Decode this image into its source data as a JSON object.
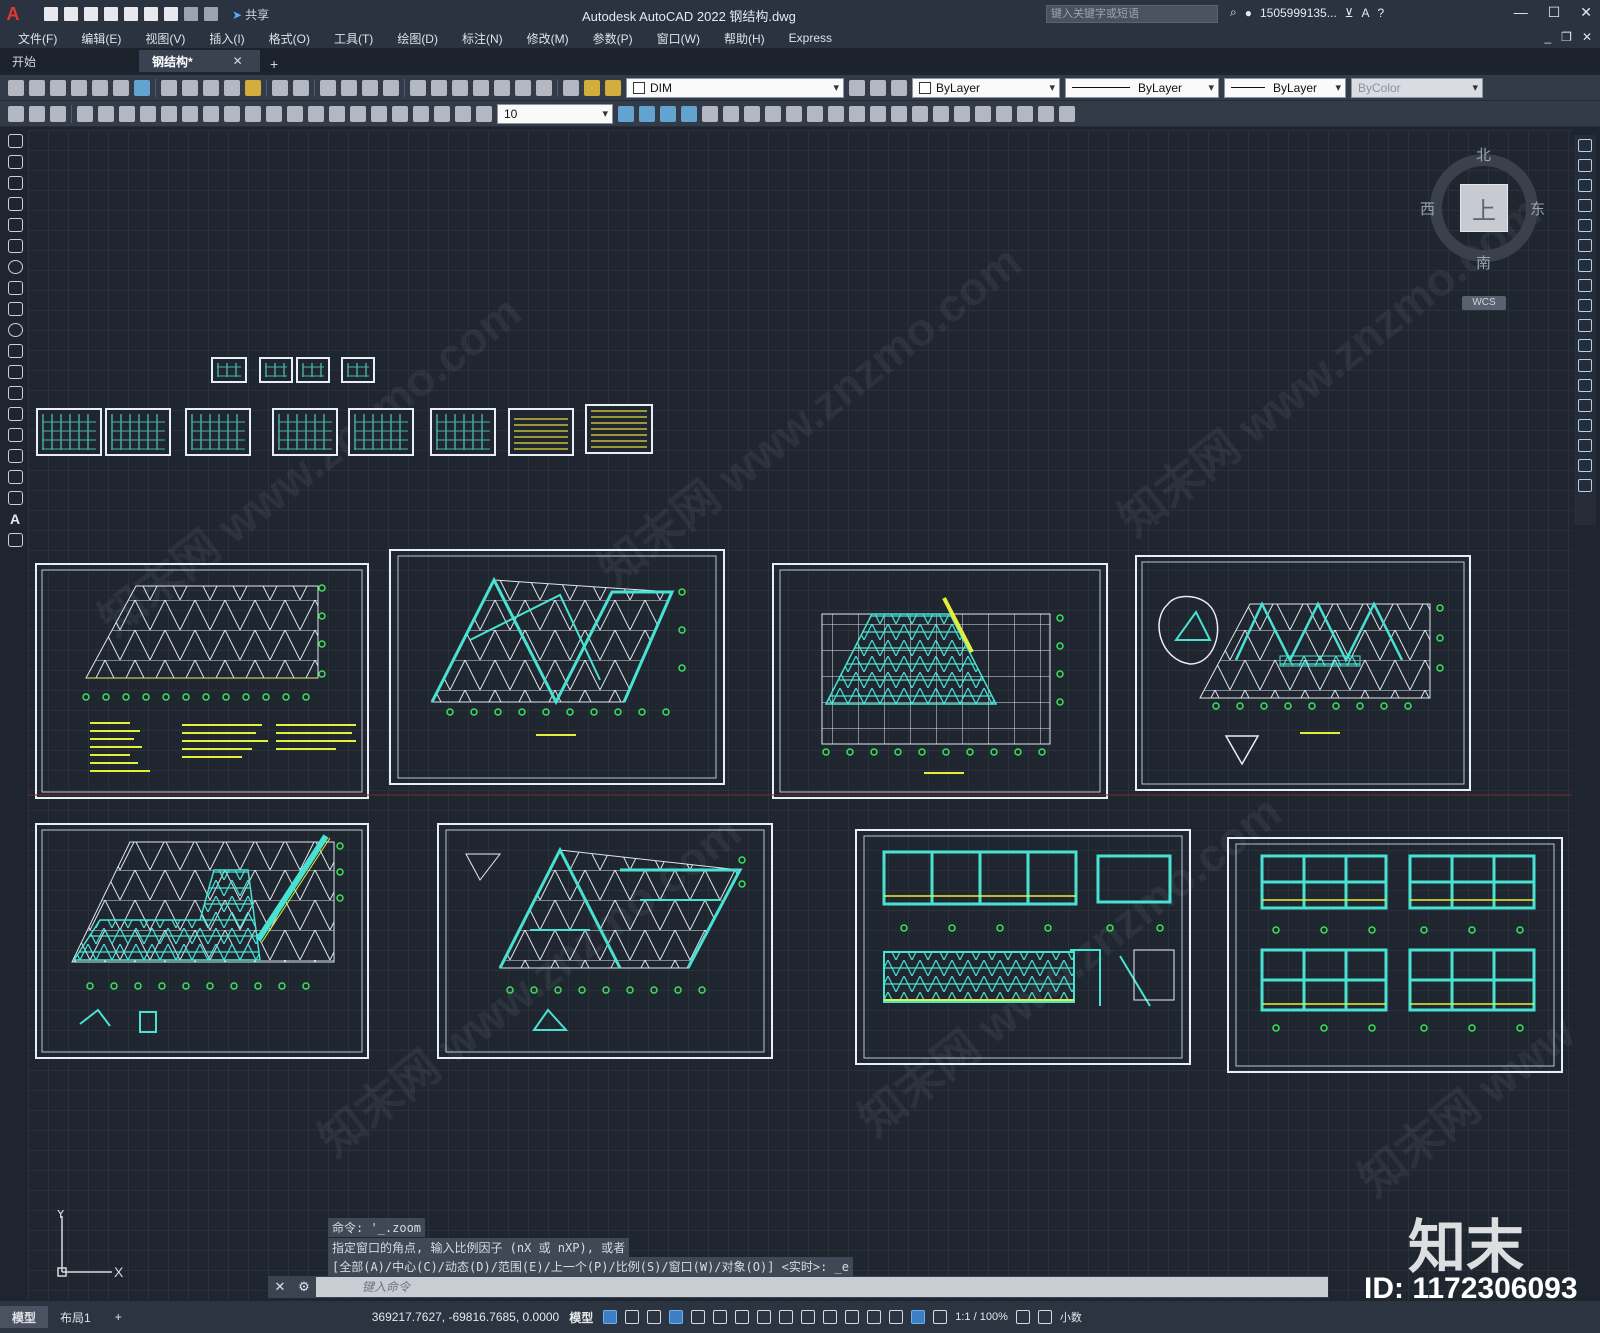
{
  "titlebar": {
    "app_title": "Autodesk AutoCAD 2022    钢结构.dwg",
    "share": "共享",
    "search_placeholder": "键入关键字或短语",
    "user": "1505999135...",
    "logo": "A"
  },
  "menu": {
    "items": [
      "文件(F)",
      "编辑(E)",
      "视图(V)",
      "插入(I)",
      "格式(O)",
      "工具(T)",
      "绘图(D)",
      "标注(N)",
      "修改(M)",
      "参数(P)",
      "窗口(W)",
      "帮助(H)",
      "Express"
    ]
  },
  "tabs": {
    "start": "开始",
    "file": "钢结构*"
  },
  "toolbar": {
    "layer": "DIM",
    "color": "ByLayer",
    "linetype": "ByLayer",
    "lineweight": "ByLayer",
    "plotstyle": "ByColor",
    "dimscale": "10"
  },
  "viewcube": {
    "north": "北",
    "south": "南",
    "east": "东",
    "west": "西",
    "top": "上",
    "wcs": "WCS"
  },
  "command": {
    "history": [
      "命令: '_.zoom",
      "指定窗口的角点, 输入比例因子 (nX 或 nXP), 或者",
      "[全部(A)/中心(C)/动态(D)/范围(E)/上一个(P)/比例(S)/窗口(W)/对象(O)] <实时>: _e"
    ],
    "placeholder": "键入命令"
  },
  "ucs": {
    "x": "X",
    "y": "Y"
  },
  "status": {
    "model_tab": "模型",
    "layout_tab": "布局1",
    "coords": "369217.7627, -69816.7685, 0.0000",
    "model": "模型",
    "scale": "1:1 / 100%",
    "units": "小数"
  },
  "watermark": {
    "brand": "知末",
    "id": "ID: 1172306093",
    "diag": "知末网 www.znzmo.com"
  }
}
